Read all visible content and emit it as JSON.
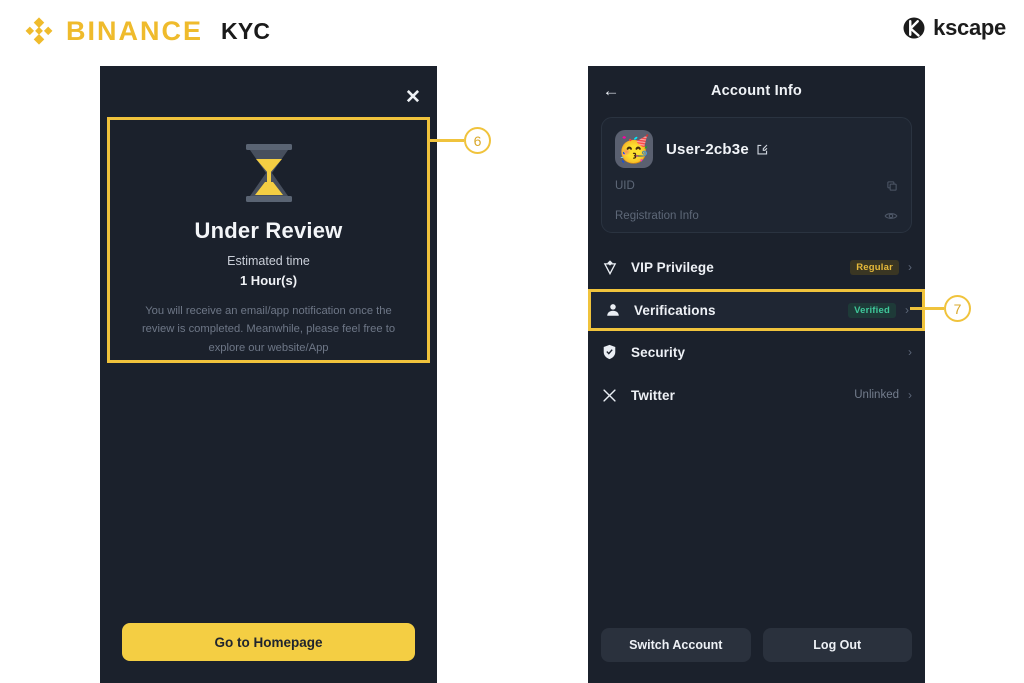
{
  "header": {
    "brand_name": "BINANCE",
    "brand_sub": "KYC",
    "brand_logo_icon": "binance-diamond-icon",
    "partner_name": "kscape",
    "partner_logo_icon": "kscape-circle-icon",
    "brand_color": "#EFBB2C"
  },
  "left_screen": {
    "close_icon": "close-icon",
    "close_label": "✕",
    "hourglass_icon": "hourglass-icon",
    "title": "Under Review",
    "estimated_label": "Estimated time",
    "estimated_value": "1 Hour(s)",
    "description": "You will receive an email/app notification once the review is completed. Meanwhile, please feel free to explore our website/App",
    "primary_button": "Go to Homepage",
    "highlight_color": "#F0C33C",
    "button_color": "#F4CE43"
  },
  "right_screen": {
    "back_icon": "back-arrow-icon",
    "back_label": "←",
    "title": "Account Info",
    "profile": {
      "avatar_icon": "party-face-avatar",
      "avatar_glyph": "🥳",
      "username": "User-2cb3e",
      "edit_icon": "edit-pencil-icon",
      "rows": [
        {
          "label": "UID",
          "icon": "copy-icon"
        },
        {
          "label": "Registration Info",
          "icon": "eye-icon"
        }
      ]
    },
    "menu": [
      {
        "label": "VIP Privilege",
        "icon": "vip-gem-icon",
        "badge": "Regular",
        "badge_kind": "regular",
        "status": "",
        "chevron": "›",
        "highlighted": false
      },
      {
        "label": "Verifications",
        "icon": "person-icon",
        "badge": "Verified",
        "badge_kind": "verified",
        "status": "",
        "chevron": "›",
        "highlighted": true
      },
      {
        "label": "Security",
        "icon": "shield-icon",
        "badge": "",
        "badge_kind": "",
        "status": "",
        "chevron": "›",
        "highlighted": false
      },
      {
        "label": "Twitter",
        "icon": "twitter-x-icon",
        "badge": "",
        "badge_kind": "",
        "status": "Unlinked",
        "chevron": "›",
        "highlighted": false
      }
    ],
    "switch_account_button": "Switch Account",
    "log_out_button": "Log Out"
  },
  "callouts": [
    {
      "number": "⑥",
      "label": "6",
      "target": "under-review-card"
    },
    {
      "number": "⑦",
      "label": "7",
      "target": "verifications-row"
    }
  ]
}
